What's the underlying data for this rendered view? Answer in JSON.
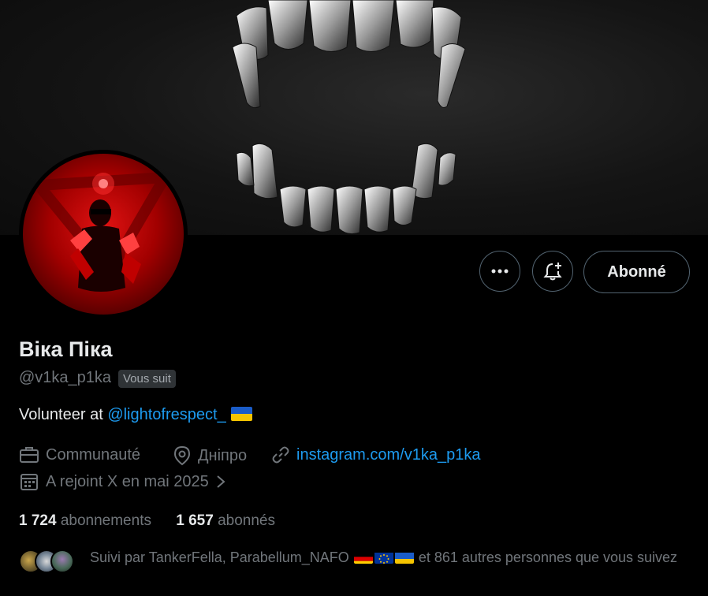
{
  "profile": {
    "name": "Віка Піка",
    "handle": "@v1ka_p1ka",
    "follows_you_badge": "Vous suit",
    "bio_prefix": "Volunteer at ",
    "bio_mention": "@lightofrespect_",
    "bio_flag": "ukraine-flag"
  },
  "actions": {
    "more_icon": "more-dots-icon",
    "notify_icon": "bell-plus-icon",
    "follow_label": "Abonné"
  },
  "meta": {
    "category": "Communauté",
    "location": "Дніпро",
    "website": "instagram.com/v1ka_p1ka",
    "joined": "A rejoint X en mai 2025"
  },
  "stats": {
    "following_count": "1 724",
    "following_label": "abonnements",
    "followers_count": "1 657",
    "followers_label": "abonnés"
  },
  "followed_by": {
    "prefix": "Suivi par TankerFella, Parabellum_NAFO",
    "flags": [
      "germany-flag",
      "eu-flag",
      "ukraine-flag"
    ],
    "suffix": "et 861 autres personnes que vous suivez"
  },
  "colors": {
    "link": "#1d9bf0",
    "muted": "#71767b",
    "text": "#e7e9ea",
    "border": "#536471"
  }
}
